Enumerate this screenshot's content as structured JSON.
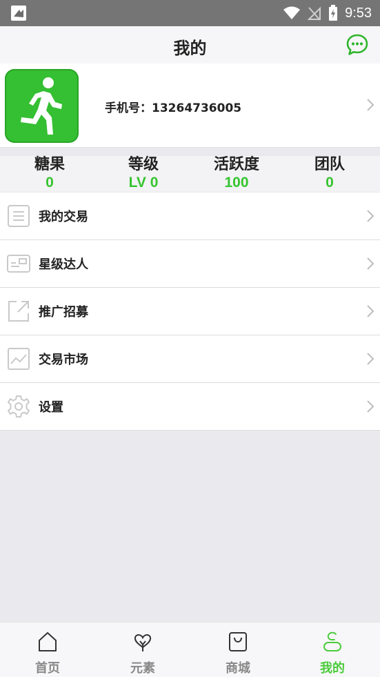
{
  "status_bar": {
    "time": "9:53"
  },
  "header": {
    "title": "我的"
  },
  "profile": {
    "phone_label": "手机号",
    "phone_sep": "：",
    "phone_number": "13264736005"
  },
  "stats": [
    {
      "name": "糖果",
      "value": "0"
    },
    {
      "name": "等级",
      "value": "LV 0"
    },
    {
      "name": "活跃度",
      "value": "100"
    },
    {
      "name": "团队",
      "value": "0"
    }
  ],
  "menu": [
    {
      "label": "我的交易",
      "icon": "list-icon"
    },
    {
      "label": "星级达人",
      "icon": "id-card-icon"
    },
    {
      "label": "推广招募",
      "icon": "share-icon"
    },
    {
      "label": "交易市场",
      "icon": "chart-icon"
    },
    {
      "label": "设置",
      "icon": "gear-icon"
    }
  ],
  "nav": [
    {
      "label": "首页",
      "icon": "home-icon"
    },
    {
      "label": "元素",
      "icon": "element-icon"
    },
    {
      "label": "商城",
      "icon": "shop-icon"
    },
    {
      "label": "我的",
      "icon": "user-icon",
      "active": true
    }
  ],
  "colors": {
    "accent": "#35c42f",
    "avatar_bg": "#35bf32",
    "status_bar": "#757575"
  }
}
